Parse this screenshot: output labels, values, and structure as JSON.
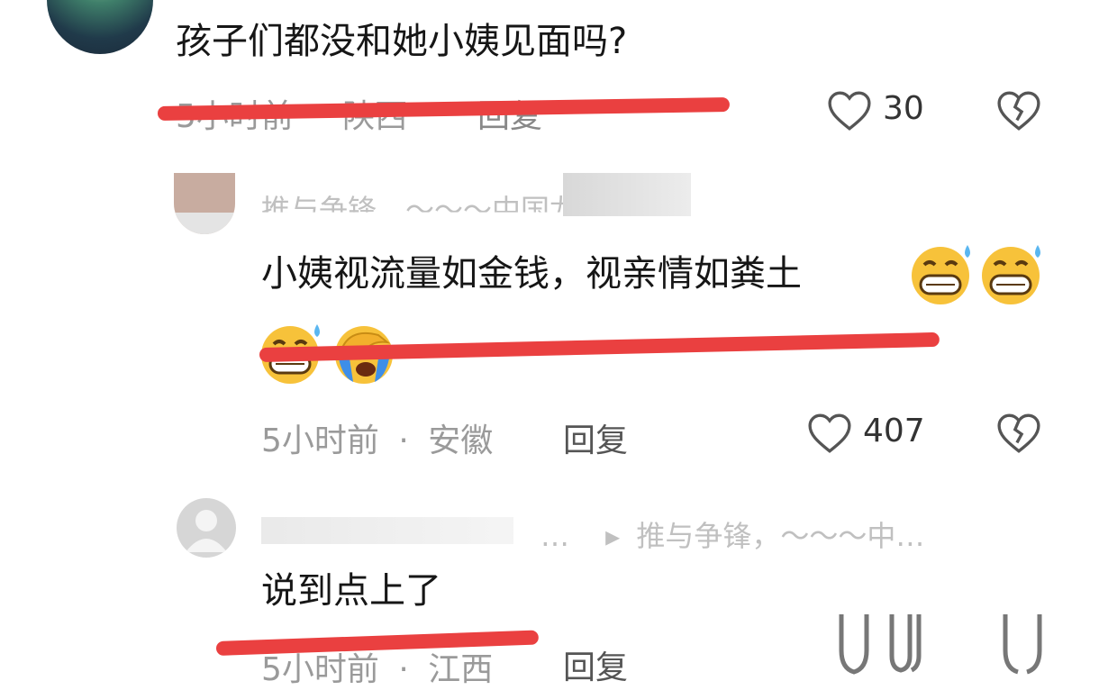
{
  "comments": [
    {
      "text": "孩子们都没和她小姨见面吗?",
      "time": "5小时前",
      "sep": "·",
      "location": "陕西",
      "reply": "回复",
      "likes": "30"
    },
    {
      "user": "推与争锋，～～～中国龙",
      "text": "小姨视流量如金钱，视亲情如粪土",
      "time": "5小时前",
      "sep": "·",
      "location": "安徽",
      "reply": "回复",
      "likes": "407"
    },
    {
      "user_left": "…",
      "user_arrow": "▸",
      "user_right": "推与争锋，～～～中…",
      "text": "说到点上了",
      "time": "5小时前",
      "sep": "·",
      "location": "江西",
      "reply": "回复"
    }
  ],
  "colors": {
    "annotation": "#ea4040",
    "emoji": "#f7c23a"
  },
  "icons": [
    "heart-icon",
    "broken-heart-icon",
    "default-avatar-icon",
    "grinning-sweat-emoji",
    "facepalm-crying-emoji"
  ]
}
